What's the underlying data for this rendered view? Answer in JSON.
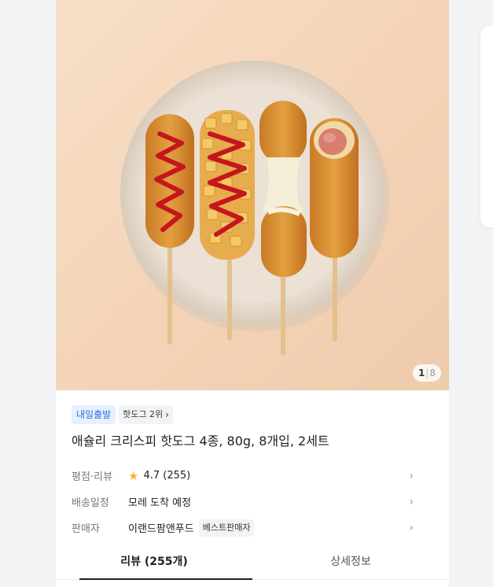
{
  "gallery": {
    "current": "1",
    "separator": "|",
    "total": "8"
  },
  "badges": {
    "delivery": "내일출발",
    "rank": "핫도그 2위",
    "rank_chevron": "chevron-right-icon"
  },
  "product": {
    "title": "애슐리 크리스피 핫도그 4종, 80g, 8개입, 2세트"
  },
  "rows": {
    "rating": {
      "label": "평점·리뷰",
      "star_icon": "star-icon",
      "value": "4.7 (255)"
    },
    "shipping": {
      "label": "배송일정",
      "value": "모레 도착 예정"
    },
    "seller": {
      "label": "판매자",
      "value": "이랜드팜앤푸드",
      "badge": "베스트판매자"
    }
  },
  "tabs": {
    "reviews": "리뷰 (255개)",
    "details": "상세정보"
  },
  "colors": {
    "accent_blue": "#2d6fe0",
    "star": "#f8b32b",
    "hero_bg": "#f3d2b5"
  }
}
